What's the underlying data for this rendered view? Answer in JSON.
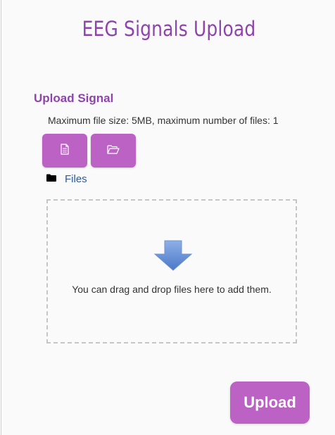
{
  "page": {
    "title": "EEG Signals Upload"
  },
  "upload_form": {
    "section_label": "Upload Signal",
    "limits_text": "Maximum file size: 5MB, maximum number of files: 1",
    "file_picker_icon": "file-icon",
    "create_folder_icon": "folder-open-icon",
    "files_folder_icon": "folder-icon",
    "files_link": "Files",
    "dropzone_icon": "down-arrow-icon",
    "dropzone_text": "You can drag and drop files here to add them.",
    "submit_label": "Upload"
  },
  "colors": {
    "accent": "#8e44ad",
    "button": "#bb62c4",
    "link": "#2f5a9a"
  }
}
